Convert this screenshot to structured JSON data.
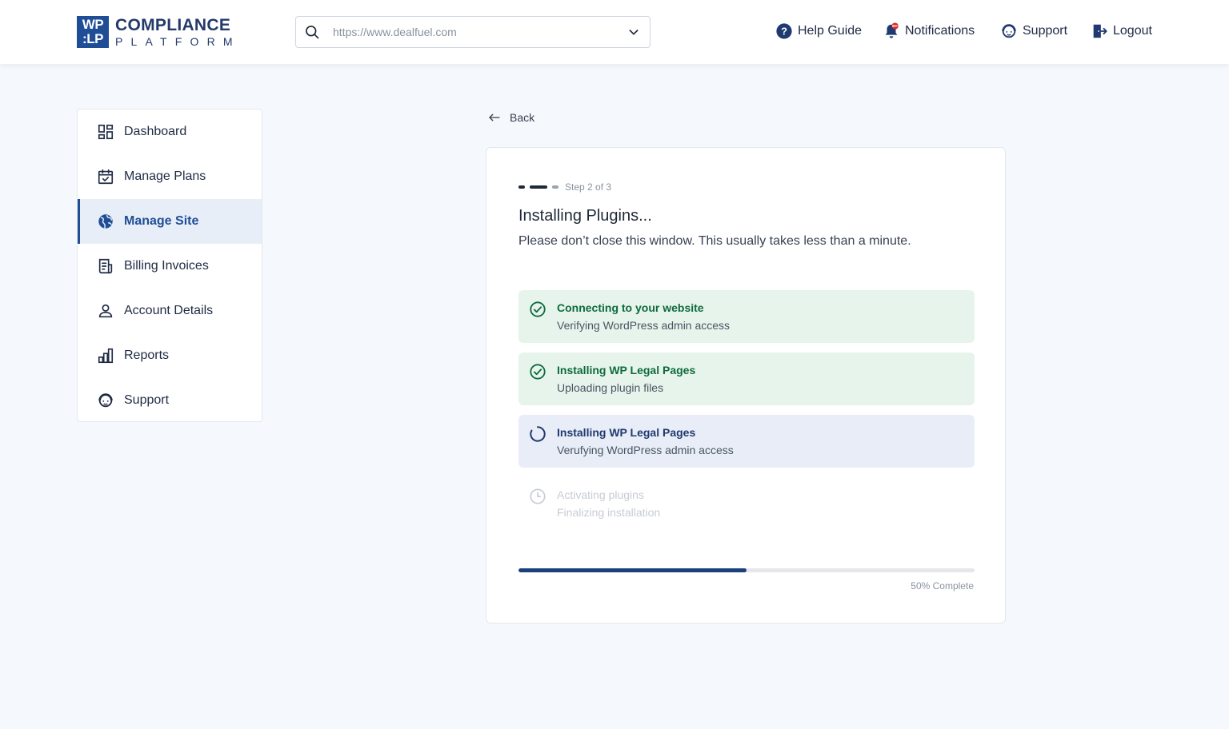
{
  "header": {
    "logo": {
      "mark_line1": "WP",
      "mark_line2": ":LP",
      "title": "COMPLIANCE",
      "subtitle": "PLATFORM"
    },
    "site_select": {
      "value": "https://www.dealfuel.com"
    },
    "nav": [
      {
        "label": "Help Guide",
        "icon": "help-circle-icon"
      },
      {
        "label": "Notifications",
        "icon": "bell-icon",
        "badge": "99+"
      },
      {
        "label": "Support",
        "icon": "support-agent-icon"
      },
      {
        "label": "Logout",
        "icon": "logout-icon"
      }
    ]
  },
  "sidebar": {
    "items": [
      {
        "label": "Dashboard",
        "icon": "dashboard-icon"
      },
      {
        "label": "Manage Plans",
        "icon": "calendar-check-icon"
      },
      {
        "label": "Manage Site",
        "icon": "globe-icon",
        "active": true
      },
      {
        "label": "Billing Invoices",
        "icon": "invoice-icon"
      },
      {
        "label": "Account Details",
        "icon": "user-icon"
      },
      {
        "label": "Reports",
        "icon": "bar-chart-icon"
      },
      {
        "label": "Support",
        "icon": "support-agent-icon"
      }
    ]
  },
  "back_label": "Back",
  "card": {
    "step_label": "Step 2 of 3",
    "title": "Installing Plugins...",
    "subtitle": "Please don’t close this window. This usually takes less than a minute.",
    "tasks": [
      {
        "title": "Connecting to your website",
        "subtitle": "Verifying WordPress admin access",
        "status": "done"
      },
      {
        "title": "Installing WP Legal Pages",
        "subtitle": "Uploading plugin files",
        "status": "done"
      },
      {
        "title": "Installing WP Legal Pages",
        "subtitle": "Verufying WordPress admin access",
        "status": "in-progress"
      },
      {
        "title": "Activating plugins",
        "subtitle": "Finalizing installation",
        "status": "pending"
      }
    ],
    "progress": {
      "percent": 50,
      "label": "50% Complete"
    }
  },
  "colors": {
    "brand": "#1f4e96",
    "success": "#0f6b3b",
    "success_bg": "#e6f4ec",
    "active_bg": "#e8edf7",
    "progress": "#1a3f7a",
    "badge": "#d62828"
  }
}
